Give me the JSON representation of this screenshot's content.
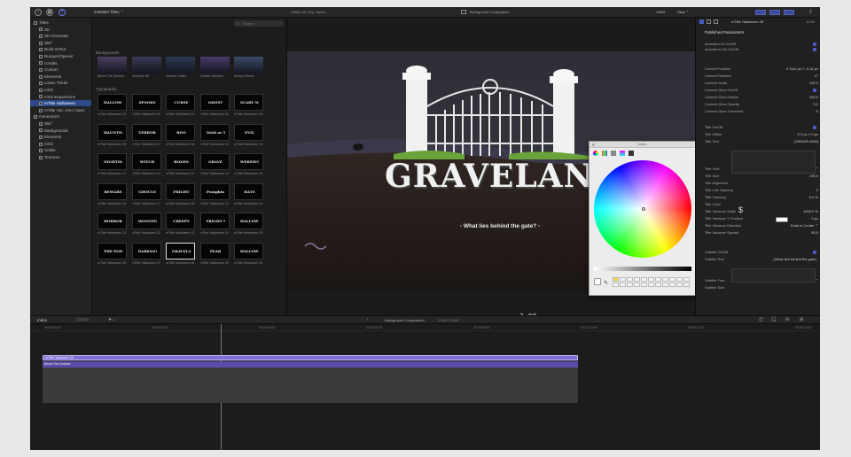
{
  "toolbar": {
    "library_dropdown": "Installed Titles ⌃",
    "project_title": "1080p HD 24p, Stereo",
    "clip_name": "Background Composition",
    "zoom": "130%",
    "view_menu": "View ⌃",
    "timecode": "3:08"
  },
  "sidebar": {
    "items": [
      {
        "label": "Titles",
        "sel": false
      },
      {
        "label": "3D",
        "sel": false
      },
      {
        "label": "3D Cinematic",
        "sel": false
      },
      {
        "label": "360°",
        "sel": false
      },
      {
        "label": "Build In/Out",
        "sel": false
      },
      {
        "label": "Bumper/Opener",
        "sel": false
      },
      {
        "label": "Credits",
        "sel": false
      },
      {
        "label": "Custom",
        "sel": false
      },
      {
        "label": "Elements",
        "sel": false
      },
      {
        "label": "Lower Thirds",
        "sel": false
      },
      {
        "label": "mO2",
        "sel": false
      },
      {
        "label": "mO2 Expansions",
        "sel": false
      },
      {
        "label": "mTitle Halloween",
        "sel": true
      },
      {
        "label": "mTitle Hal...leen Open",
        "sel": false
      },
      {
        "label": "Generators",
        "sel": false
      },
      {
        "label": "360°",
        "sel": false
      },
      {
        "label": "Backgrounds",
        "sel": false
      },
      {
        "label": "Elements",
        "sel": false
      },
      {
        "label": "mO2",
        "sel": false
      },
      {
        "label": "Solids",
        "sel": false
      },
      {
        "label": "Textures",
        "sel": false
      }
    ]
  },
  "browser": {
    "search_placeholder": "Search",
    "section_backgrounds": "Backgrounds",
    "section_typography": "Typography",
    "backgrounds": [
      "Below The Surface",
      "Haunted Hill",
      "Sinister Castle",
      "Sinister Mansion",
      "Mossy Woods"
    ],
    "thumb_labels": [
      "HALLOWEEN",
      "SPOOKY",
      "CURSE",
      "GHOST",
      "SCARY NIGHT",
      "HAUNTED",
      "TERROR",
      "BOO",
      "Trick or Treat",
      "EVIL",
      "NIGHTMARE",
      "WITCH",
      "BONES",
      "GRAVE",
      "WEREWOLF",
      "BEWARE",
      "GHOULS",
      "FRIGHT",
      "Pumpkin",
      "BATS",
      "HORROR",
      "MONSTER",
      "CREEPY",
      "FRIGHT NIGHT",
      "HALLOWEEN",
      "THE END",
      "DARKNESS",
      "GRAVELAND",
      "FEAR",
      "HALLOWEEN"
    ],
    "thumb_captions": [
      "mTitle Halloween 01",
      "mTitle Halloween 02",
      "mTitle Halloween 03",
      "mTitle Halloween 04",
      "mTitle Halloween 05",
      "mTitle Halloween 06",
      "mTitle Halloween 07",
      "mTitle Halloween 08",
      "mTitle Halloween 09",
      "mTitle Halloween 10",
      "mTitle Halloween 11",
      "mTitle Halloween 12",
      "mTitle Halloween 13",
      "mTitle Halloween 14",
      "mTitle Halloween 15",
      "mTitle Halloween 16",
      "mTitle Halloween 17",
      "mTitle Halloween 18",
      "mTitle Halloween 19",
      "mTitle Halloween 20",
      "mTitle Halloween 21",
      "mTitle Halloween 22",
      "mTitle Halloween 23",
      "mTitle Halloween 24",
      "mTitle Halloween 25",
      "mTitle Halloween 26",
      "mTitle Halloween 27",
      "mTitle Halloween 28",
      "mTitle Halloween 29",
      "mTitle Halloween 30"
    ]
  },
  "viewer": {
    "title_text": "GRAVELAND",
    "subtitle_text": "- What lies behind the gate? -"
  },
  "picker": {
    "title": "Colors"
  },
  "inspector": {
    "clip_title": "mTitle Halloween 28",
    "clip_duration": "10:00",
    "published_parameters": "Published Parameters",
    "rows": [
      {
        "label": "Animation In On/Off",
        "value": ""
      },
      {
        "label": "Animation Out On/Off",
        "value": ""
      },
      {
        "label": "Content Position",
        "value": "X  0,61 px   Y  -0,34 px"
      },
      {
        "label": "Content Rotation",
        "value": "0°"
      },
      {
        "label": "Content Scale",
        "value": "100,0"
      },
      {
        "label": "Content Glow On/Off",
        "value": ""
      },
      {
        "label": "Content Glow Radius",
        "value": "100,0"
      },
      {
        "label": "Content Glow Opacity",
        "value": "0,1"
      },
      {
        "label": "Content Glow Threshold",
        "value": "0"
      },
      {
        "label": "Title On/Off",
        "value": ""
      },
      {
        "label": "Title Offset",
        "value": "X  0 px   Y  0 px"
      },
      {
        "label": "Title Text",
        "value": "[GRAVELAND]"
      },
      {
        "label": "Title Font",
        "value": "Metal Mania  ⌃   Regular ⌃"
      },
      {
        "label": "Title Size",
        "value": "195,0"
      },
      {
        "label": "Title Alignment",
        "value": ""
      },
      {
        "label": "Title Line Spacing",
        "value": "0"
      },
      {
        "label": "Title Tracking",
        "value": "0,0 %"
      },
      {
        "label": "Title Color",
        "value": ""
      },
      {
        "label": "Title Variance Scale",
        "value": "1000,0 %"
      },
      {
        "label": "Title Variance Y Position",
        "value": "0 px"
      },
      {
        "label": "Title Variance Direction",
        "value": "Ends to Center ⌃"
      },
      {
        "label": "Title Variance Spread",
        "value": "50,0"
      },
      {
        "label": "Subtitle On/Off",
        "value": ""
      },
      {
        "label": "Subtitle Text",
        "value": "- [What lies behind the gate] -"
      },
      {
        "label": "Subtitle Font",
        "value": "Chelsea Mark...  ⌃  Regular ⌃"
      },
      {
        "label": "Subtitle Size",
        "value": ""
      }
    ]
  },
  "timeline": {
    "index_label": "Index",
    "clip_title": "Background Composition",
    "duration": "10:00 / 10:00",
    "ticks": [
      "00:00:00:00",
      "00:00:02:00",
      "00:00:04:00",
      "00:00:06:00",
      "00:00:08:00",
      "00:00:10:00",
      "00:00:12:00",
      "00:00:14:00"
    ],
    "title_clip_label": "mTitle Halloween 28",
    "bg_clip_label": "Below The Surface"
  },
  "colors": {
    "accent": "#4a5ec7",
    "selection": "#2c4a8a",
    "clip_purple": "#5a4da8"
  }
}
